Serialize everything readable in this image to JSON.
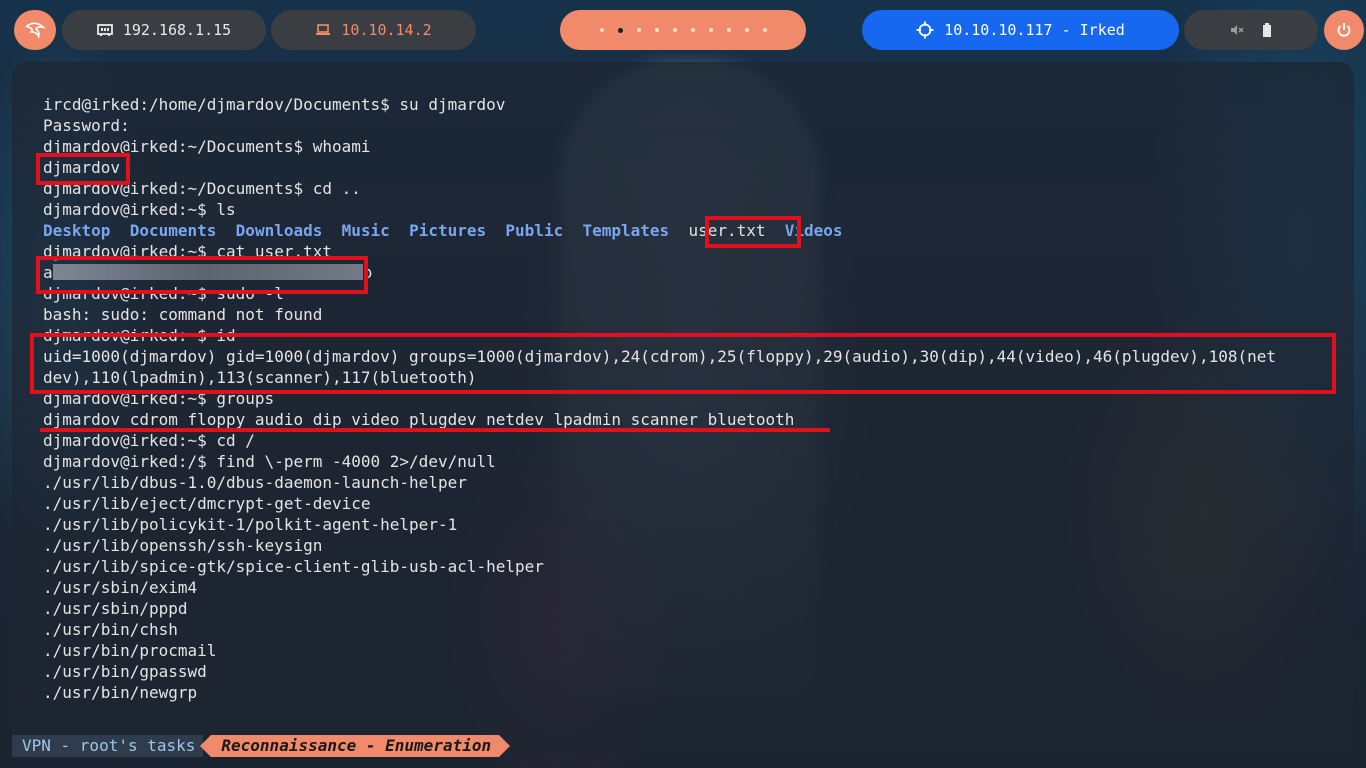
{
  "topbar": {
    "logo_icon": "kali-dragon-icon",
    "local_ip": "192.168.1.15",
    "local_ip_icon": "network-card-icon",
    "vpn_ip": "10.10.14.2",
    "vpn_ip_icon": "laptop-icon",
    "workspaces": {
      "count": 10,
      "active_index": 1
    },
    "target": "10.10.10.117 - Irked",
    "target_icon": "crosshair-icon",
    "system_icons": [
      "muted-speaker-icon",
      "battery-icon"
    ],
    "power_icon": "power-icon"
  },
  "terminal": {
    "lines": [
      "ircd@irked:/home/djmardov/Documents$ su djmardov",
      "Password:",
      "djmardov@irked:~/Documents$ whoami",
      "djmardov",
      "djmardov@irked:~/Documents$ cd ..",
      "djmardov@irked:~$ ls",
      null,
      "djmardov@irked:~$ cat user.txt",
      null,
      "djmardov@irked:~$ sudo -l",
      "bash: sudo: command not found",
      "djmardov@irked:~$ id",
      "uid=1000(djmardov) gid=1000(djmardov) groups=1000(djmardov),24(cdrom),25(floppy),29(audio),30(dip),44(video),46(plugdev),108(net",
      "dev),110(lpadmin),113(scanner),117(bluetooth)",
      "djmardov@irked:~$ groups",
      "djmardov cdrom floppy audio dip video plugdev netdev lpadmin scanner bluetooth",
      "djmardov@irked:~$ cd /",
      "djmardov@irked:/$ find \\-perm -4000 2>/dev/null",
      "./usr/lib/dbus-1.0/dbus-daemon-launch-helper",
      "./usr/lib/eject/dmcrypt-get-device",
      "./usr/lib/policykit-1/polkit-agent-helper-1",
      "./usr/lib/openssh/ssh-keysign",
      "./usr/lib/spice-gtk/spice-client-glib-usb-acl-helper",
      "./usr/sbin/exim4",
      "./usr/sbin/pppd",
      "./usr/bin/chsh",
      "./usr/bin/procmail",
      "./usr/bin/gpasswd",
      "./usr/bin/newgrp"
    ],
    "ls_output": {
      "dirs_a": [
        "Desktop",
        "Documents",
        "Downloads",
        "Music",
        "Pictures",
        "Public",
        "Templates"
      ],
      "file": "user.txt",
      "dirs_b": [
        "Videos"
      ]
    },
    "flag": {
      "first_char": "a",
      "last_char": "b"
    }
  },
  "statusbar": {
    "left_label": "VPN - root's tasks",
    "right_label": "Reconnaissance - Enumeration"
  },
  "colors": {
    "accent": "#f08a6a",
    "target_blue": "#1668f0",
    "directory": "#7aa6f0",
    "highlight_red": "#e0101c"
  }
}
